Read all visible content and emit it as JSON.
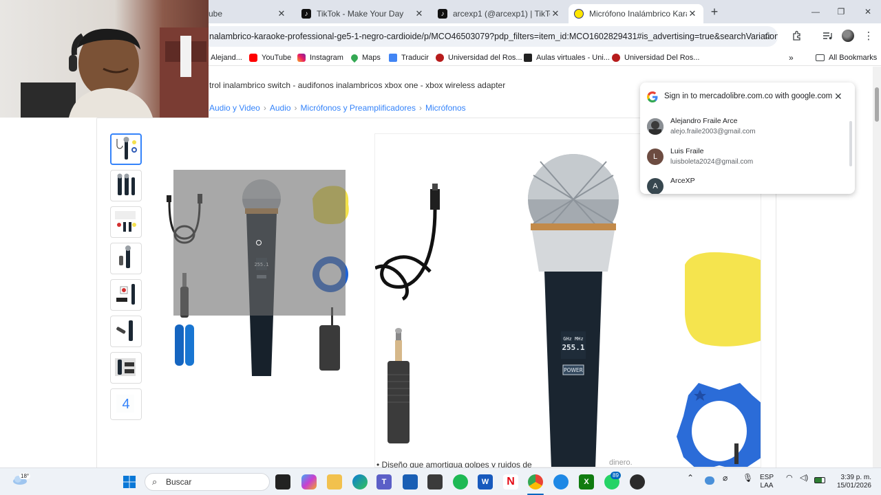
{
  "tabs": [
    {
      "label": "ube",
      "icon": "youtube-icon"
    },
    {
      "label": "TikTok - Make Your Day",
      "icon": "tiktok-icon"
    },
    {
      "label": "arcexp1 (@arcexp1) | TikTok",
      "icon": "tiktok-icon"
    },
    {
      "label": "Micrófono Inalámbrico Karaoke",
      "icon": "mercadolibre-icon",
      "active": true
    }
  ],
  "window_controls": [
    "minimize-icon",
    "restore-icon",
    "close-icon"
  ],
  "address_bar": {
    "url": "nalambrico-karaoke-professional-ge5-1-negro-cardioide/p/MCO46503079?pdp_filters=item_id:MCO1602829431#is_advertising=true&searchVariation=..."
  },
  "bookmarks": [
    {
      "label": "Alejand...",
      "icon": "bookmark-icon"
    },
    {
      "label": "YouTube",
      "icon": "youtube-icon"
    },
    {
      "label": "Instagram",
      "icon": "instagram-icon"
    },
    {
      "label": "Maps",
      "icon": "maps-icon"
    },
    {
      "label": "Traducir",
      "icon": "translate-icon"
    },
    {
      "label": "Universidad del Ros...",
      "icon": "university-icon"
    },
    {
      "label": "Aulas virtuales - Uni...",
      "icon": "aulas-icon"
    },
    {
      "label": "Universidad Del Ros...",
      "icon": "university-icon"
    }
  ],
  "all_bookmarks_label": "All Bookmarks",
  "page": {
    "related_searches": "trol inalambrico switch - audifonos inalambricos xbox one - xbox wireless adapter",
    "breadcrumbs": [
      "Audio y Video",
      "Audio",
      "Micrófonos y Preamplificadores",
      "Micrófonos"
    ],
    "more_images_count": "4",
    "bullet_text": "Diseño que amortigua golpes y ruidos de",
    "ghost_text": "dinero."
  },
  "google_signin": {
    "title": "Sign in to mercadolibre.com.co with google.com",
    "accounts": [
      {
        "name": "Alejandro Fraile Arce",
        "email": "alejo.fraile2003@gmail.com",
        "initial": "",
        "color": "#5a5a5a"
      },
      {
        "name": "Luis Fraile",
        "email": "luisboleta2024@gmail.com",
        "initial": "L",
        "color": "#6d4c41"
      },
      {
        "name": "ArceXP",
        "email": "",
        "initial": "A",
        "color": "#37474f"
      }
    ]
  },
  "product_display": {
    "display_reading": "255.1",
    "display_unit": "GHz MHz",
    "power_label": "POWER"
  },
  "taskbar": {
    "search_placeholder": "Buscar",
    "weather_temp": "18°",
    "whatsapp_badge": "89",
    "language": "ESP",
    "language_sub": "LAA",
    "time": "3:39 p. m.",
    "date": "15/01/2026"
  }
}
